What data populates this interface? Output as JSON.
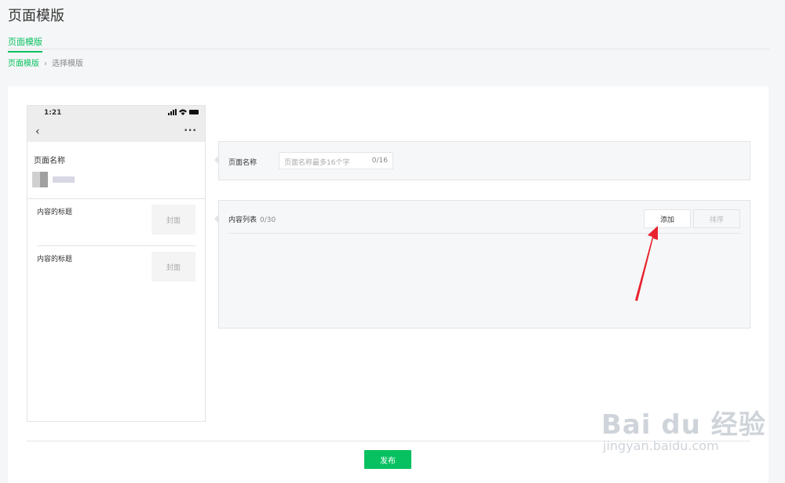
{
  "header": {
    "title": "页面模版",
    "tab": "页面模版"
  },
  "breadcrumb": {
    "parent": "页面模版",
    "current": "选择模版"
  },
  "phone": {
    "time": "1:21",
    "page_name_label": "页面名称",
    "items": [
      {
        "title": "内容的标题",
        "cover": "封面"
      },
      {
        "title": "内容的标题",
        "cover": "封面"
      }
    ]
  },
  "form": {
    "name_label": "页面名称",
    "name_placeholder": "页面名称最多16个字",
    "name_counter": "0/16",
    "content_label": "内容列表",
    "content_count": "0/30",
    "add_label": "添加",
    "sort_label": "排序"
  },
  "footer": {
    "publish_label": "发布"
  },
  "watermark": {
    "main": "Bai du 经验",
    "sub": "jingyan.baidu.com"
  },
  "colors": {
    "accent": "#07c160",
    "annotation": "#e8232e"
  }
}
